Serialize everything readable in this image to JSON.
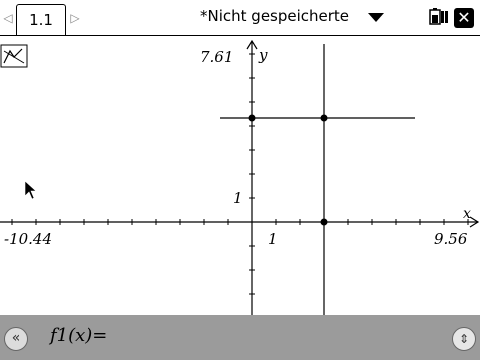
{
  "tabs": {
    "prev_icon": "left-triangle-icon",
    "next_icon": "right-triangle-icon",
    "active_label": "1.1"
  },
  "document": {
    "title": "*Nicht gespeicherte"
  },
  "graph": {
    "x_min_label": "-10.44",
    "x_max_label": "9.56",
    "y_max_label": "7.61",
    "x_tick_label": "1",
    "y_tick_label": "1",
    "x_axis_label": "x",
    "y_axis_label": "y"
  },
  "entry": {
    "label": "f1(x)=",
    "value": ""
  },
  "colors": {
    "axis": "#000000",
    "entrybar": "#9b9b9b",
    "background": "#ffffff"
  }
}
